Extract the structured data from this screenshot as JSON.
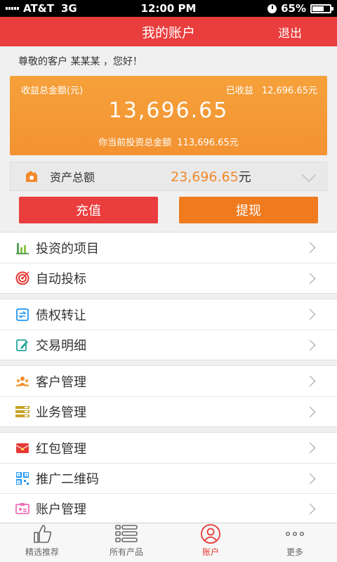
{
  "status_bar": {
    "carrier": "AT&T",
    "network": "3G",
    "time": "12:00 PM",
    "battery": "65%",
    "battery_level": 0.65
  },
  "nav": {
    "title": "我的账户",
    "action": "退出"
  },
  "greeting": "尊敬的客户 某某某 ，您好！",
  "earnings": {
    "total_label": "收益总金额(元)",
    "received_label": "已收益",
    "received_amount": "12,696.65元",
    "total_amount": "13,696.65",
    "invest_label": "你当前投资总金额",
    "invest_amount": "113,696.65元"
  },
  "assets": {
    "label": "资产总额",
    "value": "23,696.65",
    "unit": "元"
  },
  "buttons": {
    "recharge": "充值",
    "withdraw": "提现"
  },
  "menu_groups": [
    [
      {
        "label": "投资的项目",
        "icon": "bar-chart-icon"
      },
      {
        "label": "自动投标",
        "icon": "target-icon"
      }
    ],
    [
      {
        "label": "债权转让",
        "icon": "transfer-icon"
      },
      {
        "label": "交易明细",
        "icon": "edit-icon"
      }
    ],
    [
      {
        "label": "客户管理",
        "icon": "people-icon"
      },
      {
        "label": "业务管理",
        "icon": "list-icon"
      }
    ],
    [
      {
        "label": "红包管理",
        "icon": "red-envelope-icon"
      },
      {
        "label": "推广二维码",
        "icon": "qr-code-icon"
      },
      {
        "label": "账户管理",
        "icon": "account-card-icon"
      }
    ]
  ],
  "tabs": [
    {
      "label": "精选推荐",
      "icon": "thumbs-up-icon",
      "active": false
    },
    {
      "label": "所有产品",
      "icon": "list-bullets-icon",
      "active": false
    },
    {
      "label": "账户",
      "icon": "user-icon",
      "active": true
    },
    {
      "label": "更多",
      "icon": "more-dots-icon",
      "active": false
    }
  ],
  "colors": {
    "primary": "#ea3d3d",
    "card": "#f39231",
    "accent": "#f07a1e"
  }
}
